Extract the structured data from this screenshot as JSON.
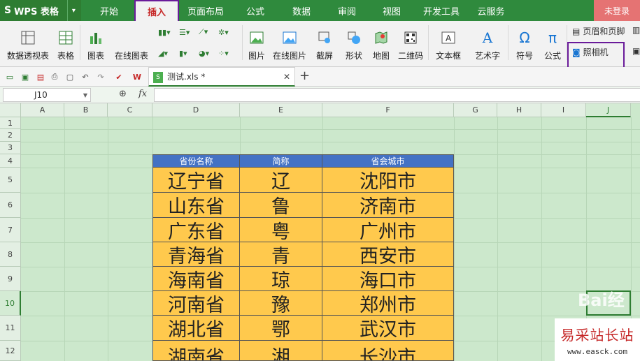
{
  "app": {
    "name": "WPS 表格",
    "login": "未登录"
  },
  "tabs": [
    {
      "label": "开始"
    },
    {
      "label": "插入"
    },
    {
      "label": "页面布局"
    },
    {
      "label": "公式"
    },
    {
      "label": "数据"
    },
    {
      "label": "审阅"
    },
    {
      "label": "视图"
    },
    {
      "label": "开发工具"
    },
    {
      "label": "云服务"
    }
  ],
  "ribbon": {
    "pivot_table": "数据透视表",
    "table": "表格",
    "chart": "图表",
    "online_chart": "在线图表",
    "picture": "图片",
    "online_picture": "在线图片",
    "screenshot": "截屏",
    "shapes": "形状",
    "map": "地图",
    "qrcode": "二维码",
    "textbox": "文本框",
    "wordart": "艺术字",
    "symbol": "符号",
    "formula": "公式",
    "header_footer": "页眉和页脚",
    "camera": "照相机"
  },
  "file_tab": {
    "name": "测试.xls *"
  },
  "formula_bar": {
    "cell_ref": "J10",
    "fx": "fx",
    "content": ""
  },
  "grid": {
    "columns": [
      "A",
      "B",
      "C",
      "D",
      "E",
      "F",
      "G",
      "H",
      "I",
      "J"
    ],
    "rows": [
      "1",
      "2",
      "3",
      "4",
      "5",
      "6",
      "7",
      "8",
      "9",
      "10",
      "11",
      "12"
    ],
    "selected_column": "J",
    "selected_row": "10"
  },
  "table": {
    "headers": [
      "省份名称",
      "简称",
      "省会城市"
    ],
    "rows": [
      [
        "辽宁省",
        "辽",
        "沈阳市"
      ],
      [
        "山东省",
        "鲁",
        "济南市"
      ],
      [
        "广东省",
        "粤",
        "广州市"
      ],
      [
        "青海省",
        "青",
        "西安市"
      ],
      [
        "海南省",
        "琼",
        "海口市"
      ],
      [
        "河南省",
        "豫",
        "郑州市"
      ],
      [
        "湖北省",
        "鄂",
        "武汉市"
      ],
      [
        "湖南省",
        "湘",
        "长沙市"
      ]
    ]
  },
  "watermark": {
    "logo": "Bai经",
    "title": "易采站长站",
    "url": "www.easck.com"
  },
  "colors": {
    "tab_bar": "#2f8a3d",
    "header_fill": "#4472c4",
    "body_fill": "#ffc94d",
    "grid_bg": "#cce8cc",
    "highlight_box": "#6a1b9a"
  }
}
